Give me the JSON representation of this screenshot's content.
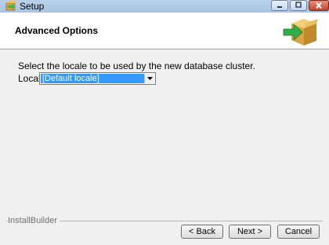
{
  "window": {
    "title": "Setup"
  },
  "header": {
    "title": "Advanced Options"
  },
  "content": {
    "description": "Select the locale to be used by the new database cluster.",
    "locale_label": "Locale",
    "locale_value": "[Default locale]"
  },
  "footer": {
    "brand": "InstallBuilder",
    "back_label": "< Back",
    "next_label": "Next >",
    "cancel_label": "Cancel"
  },
  "icons": [
    "setup-app-icon",
    "minimize-icon",
    "maximize-icon",
    "close-icon",
    "installer-box-icon",
    "dropdown-arrow-icon"
  ],
  "colors": {
    "titlebar": "#b9d1ea",
    "selection": "#3399ff",
    "close": "#c4442b"
  }
}
